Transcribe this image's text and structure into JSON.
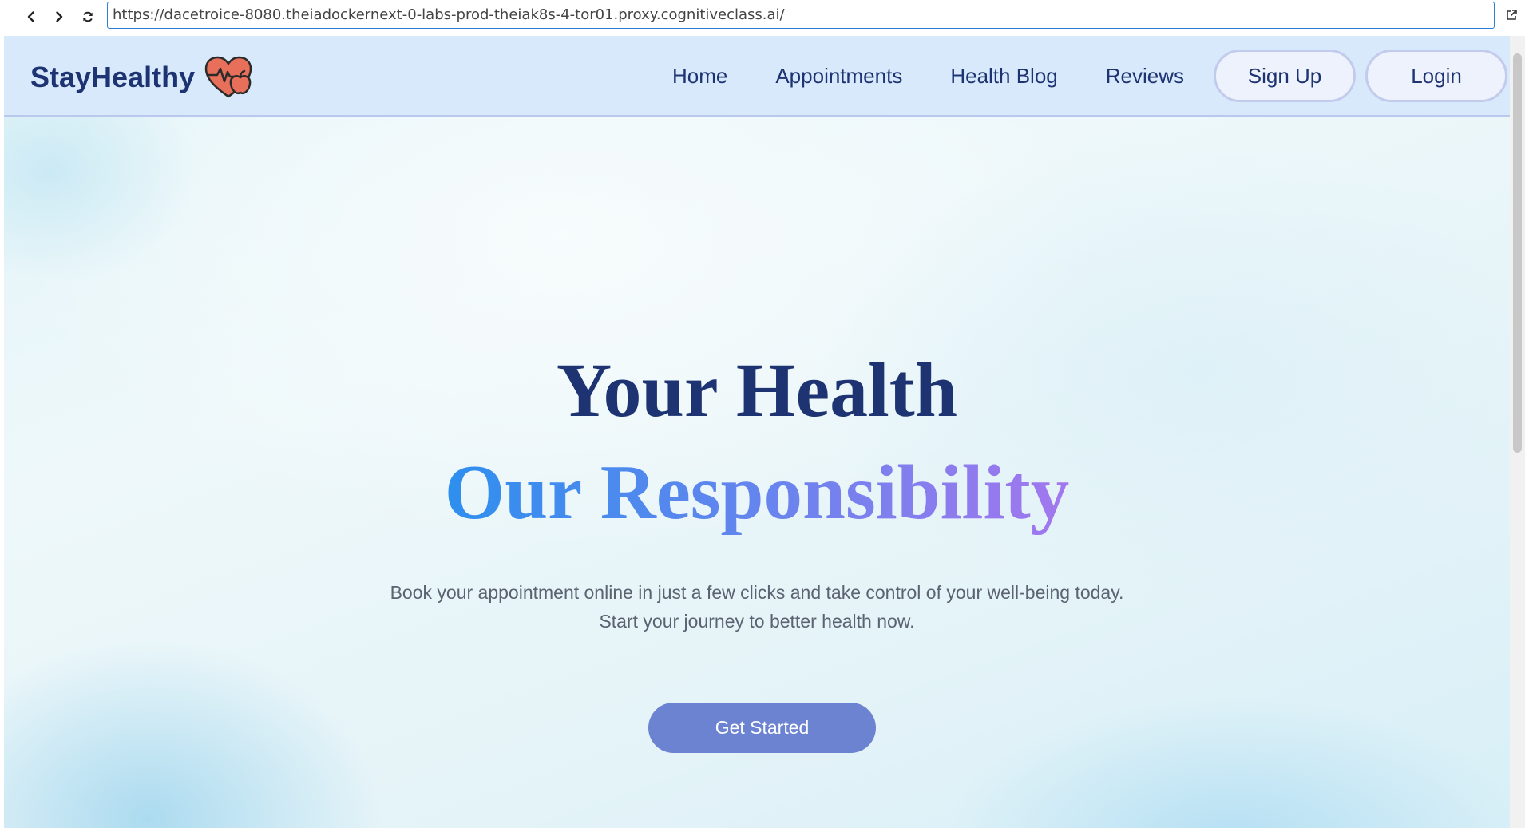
{
  "browser": {
    "url": "https://dacetroice-8080.theiadockernext-0-labs-prod-theiak8s-4-tor01.proxy.cognitiveclass.ai/",
    "back_icon": "chevron-left-icon",
    "forward_icon": "chevron-right-icon",
    "reload_icon": "reload-icon",
    "open_external_icon": "open-external-icon"
  },
  "navbar": {
    "brand": "StayHealthy",
    "logo_icon": "heart-pulse-icon",
    "links": [
      "Home",
      "Appointments",
      "Health Blog",
      "Reviews"
    ],
    "signup_label": "Sign Up",
    "login_label": "Login"
  },
  "hero": {
    "title_line1": "Your Health",
    "title_line2": "Our Responsibility",
    "subtitle_line1": "Book your appointment online in just a few clicks and take control of your well-being today.",
    "subtitle_line2": "Start your journey to better health now.",
    "cta_label": "Get Started"
  },
  "colors": {
    "brand_navy": "#1e3372",
    "navbar_bg": "#d7e9fb",
    "gradient_start": "#2e8fee",
    "gradient_end": "#a377ee",
    "cta_bg": "#6c83d1",
    "heart_red": "#e8705a"
  }
}
